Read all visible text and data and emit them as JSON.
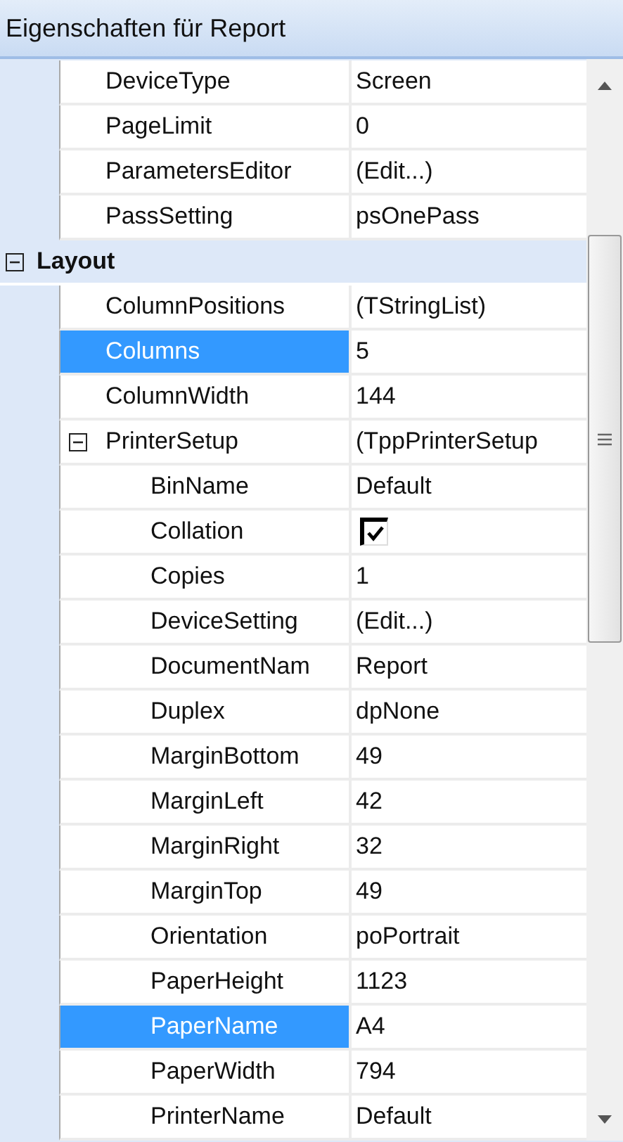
{
  "panel": {
    "title": "Eigenschaften für Report"
  },
  "properties": [
    {
      "kind": "property",
      "name": "DeviceType",
      "value": "Screen",
      "selected": false
    },
    {
      "kind": "property",
      "name": "PageLimit",
      "value": "0",
      "selected": false
    },
    {
      "kind": "property",
      "name": "ParametersEditor",
      "value": "(Edit...)",
      "selected": false
    },
    {
      "kind": "property",
      "name": "PassSetting",
      "value": "psOnePass",
      "selected": false
    },
    {
      "kind": "category",
      "name": "Layout",
      "expanded": true,
      "selected": false,
      "children": [
        {
          "kind": "property",
          "name": "ColumnPositions",
          "value": "(TStringList)",
          "selected": false
        },
        {
          "kind": "property",
          "name": "Columns",
          "value": "5",
          "selected": true
        },
        {
          "kind": "property",
          "name": "ColumnWidth",
          "value": "144",
          "selected": false
        },
        {
          "kind": "group",
          "name": "PrinterSetup",
          "value": "(TppPrinterSetup",
          "expanded": true,
          "selected": false,
          "children": [
            {
              "kind": "property",
              "name": "BinName",
              "value": "Default",
              "selected": false
            },
            {
              "kind": "checkbox",
              "name": "Collation",
              "checked": true,
              "selected": false
            },
            {
              "kind": "property",
              "name": "Copies",
              "value": "1",
              "selected": false
            },
            {
              "kind": "property",
              "name": "DeviceSetting",
              "value": "(Edit...)",
              "selected": false
            },
            {
              "kind": "property",
              "name": "DocumentNam",
              "value": "Report",
              "selected": false
            },
            {
              "kind": "property",
              "name": "Duplex",
              "value": "dpNone",
              "selected": false
            },
            {
              "kind": "property",
              "name": "MarginBottom",
              "value": "49",
              "selected": false
            },
            {
              "kind": "property",
              "name": "MarginLeft",
              "value": "42",
              "selected": false
            },
            {
              "kind": "property",
              "name": "MarginRight",
              "value": "32",
              "selected": false
            },
            {
              "kind": "property",
              "name": "MarginTop",
              "value": "49",
              "selected": false
            },
            {
              "kind": "property",
              "name": "Orientation",
              "value": "poPortrait",
              "selected": false
            },
            {
              "kind": "property",
              "name": "PaperHeight",
              "value": "1123",
              "selected": false
            },
            {
              "kind": "property",
              "name": "PaperName",
              "value": "A4",
              "selected": true
            },
            {
              "kind": "property",
              "name": "PaperWidth",
              "value": "794",
              "selected": false
            },
            {
              "kind": "property",
              "name": "PrinterName",
              "value": "Default",
              "selected": false
            }
          ]
        }
      ]
    }
  ]
}
